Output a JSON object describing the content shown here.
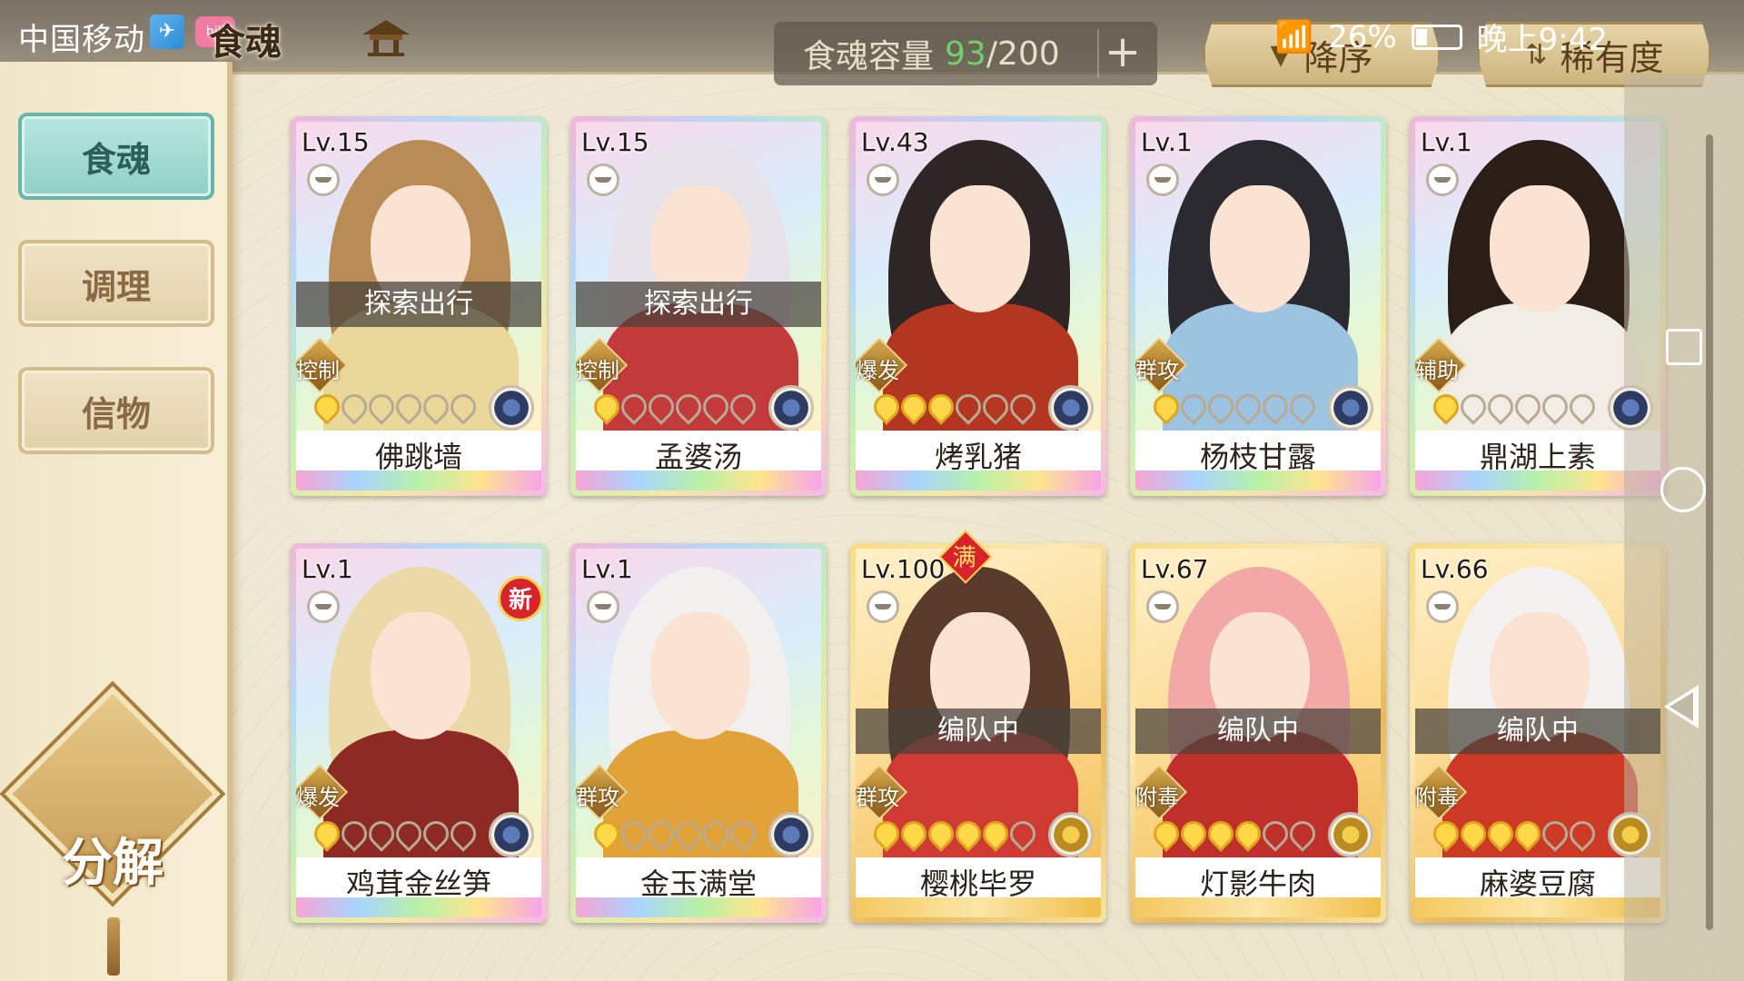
{
  "status_bar": {
    "carrier": "中国移动",
    "battery": "26%",
    "time": "晚上9:42"
  },
  "header": {
    "title": "食魂",
    "capacity_label": "食魂容量",
    "capacity_current": "93",
    "capacity_separator": "/",
    "capacity_max": "200",
    "sort_order_label": "降序",
    "sort_rarity_label": "稀有度"
  },
  "sidebar": {
    "items": [
      {
        "label": "食魂",
        "active": true
      },
      {
        "label": "调理",
        "active": false
      },
      {
        "label": "信物",
        "active": false
      }
    ],
    "decompose_label": "分解"
  },
  "cards": [
    {
      "level": "Lv.15",
      "name": "佛跳墙",
      "status": "探索出行",
      "type": "控制",
      "stars": 1,
      "frame": "rainbow",
      "hair": "#b98b55",
      "outfit": "#e9d89a"
    },
    {
      "level": "Lv.15",
      "name": "孟婆汤",
      "status": "探索出行",
      "type": "控制",
      "stars": 1,
      "frame": "rainbow",
      "hair": "#e6e3ea",
      "outfit": "#c33a3a"
    },
    {
      "level": "Lv.43",
      "name": "烤乳猪",
      "status": "",
      "type": "爆发",
      "stars": 3,
      "frame": "rainbow",
      "hair": "#2d2624",
      "outfit": "#b23620"
    },
    {
      "level": "Lv.1",
      "name": "杨枝甘露",
      "status": "",
      "type": "群攻",
      "stars": 1,
      "frame": "rainbow",
      "hair": "#2b2a30",
      "outfit": "#9cc3df"
    },
    {
      "level": "Lv.1",
      "name": "鼎湖上素",
      "status": "",
      "type": "辅助",
      "stars": 1,
      "frame": "rainbow",
      "hair": "#2a1e16",
      "outfit": "#f1ede4"
    },
    {
      "level": "Lv.1",
      "name": "鸡茸金丝笋",
      "status": "",
      "type": "爆发",
      "stars": 1,
      "frame": "rainbow",
      "hair": "#ecd9a8",
      "outfit": "#8e2a24",
      "is_new": true,
      "new_label": "新"
    },
    {
      "level": "Lv.1",
      "name": "金玉满堂",
      "status": "",
      "type": "群攻",
      "stars": 1,
      "frame": "rainbow",
      "hair": "#f1f0ef",
      "outfit": "#e2a23a"
    },
    {
      "level": "Lv.100",
      "name": "樱桃毕罗",
      "status": "编队中",
      "type": "群攻",
      "stars": 5,
      "frame": "gold",
      "hair": "#5a3a2a",
      "outfit": "#cf3b33",
      "is_max": true,
      "max_label": "满"
    },
    {
      "level": "Lv.67",
      "name": "灯影牛肉",
      "status": "编队中",
      "type": "附毒",
      "stars": 4,
      "frame": "gold",
      "hair": "#f2a9a6",
      "outfit": "#c0302a"
    },
    {
      "level": "Lv.66",
      "name": "麻婆豆腐",
      "status": "编队中",
      "type": "附毒",
      "stars": 4,
      "frame": "gold",
      "hair": "#f3f2f0",
      "outfit": "#cc3a25"
    }
  ],
  "colors": {
    "active_tab": "#8fd0c7",
    "capacity_current": "#6fd16a",
    "star_on": "#ffd84a",
    "new_badge": "#d8232a"
  },
  "icons": {
    "home": "pavilion-icon",
    "capacity_add": "plus-icon",
    "sort_order": "arrow-down-icon",
    "sort_rarity": "filter-icon"
  }
}
